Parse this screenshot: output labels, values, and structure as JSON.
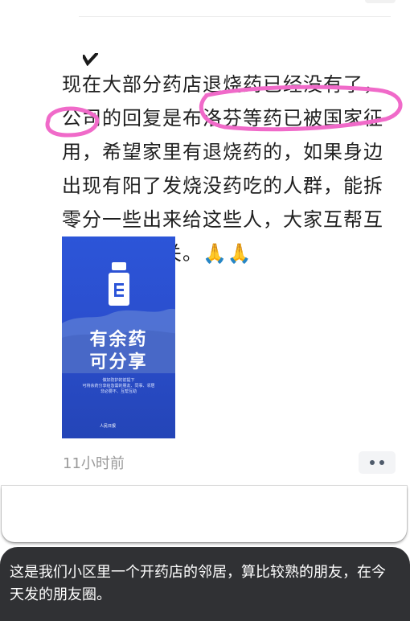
{
  "post": {
    "text": "现在大部分药店退烧药已经没有了，\n公司的回复是布洛芬等药已被国家征\n用，希望家里有退烧药的，如果身边\n出现有阳了发烧没药吃的人群，能拆\n零分一些出来给这些人，大家互帮互\n助，共度难关。",
    "emoji": "🙏🙏",
    "image": {
      "title_line1": "有余药",
      "title_line2": "可分享",
      "body_line1": "做好防护的前提下",
      "body_line2": "可将余药分享给急需的朋友、同事、邻居",
      "body_line3": "非必要不、互帮互助",
      "logo_text": "人民日报"
    },
    "time": "11小时前",
    "more_icon": "more-dots-icon"
  },
  "caption": {
    "text": "这是我们小区里一个开药店的邻居，算比较熟的朋友，在今天发的朋友圈。"
  },
  "colors": {
    "annotation": "#f06ac9",
    "image_blue": "#2c55d8",
    "caption_bg": "#303134"
  }
}
